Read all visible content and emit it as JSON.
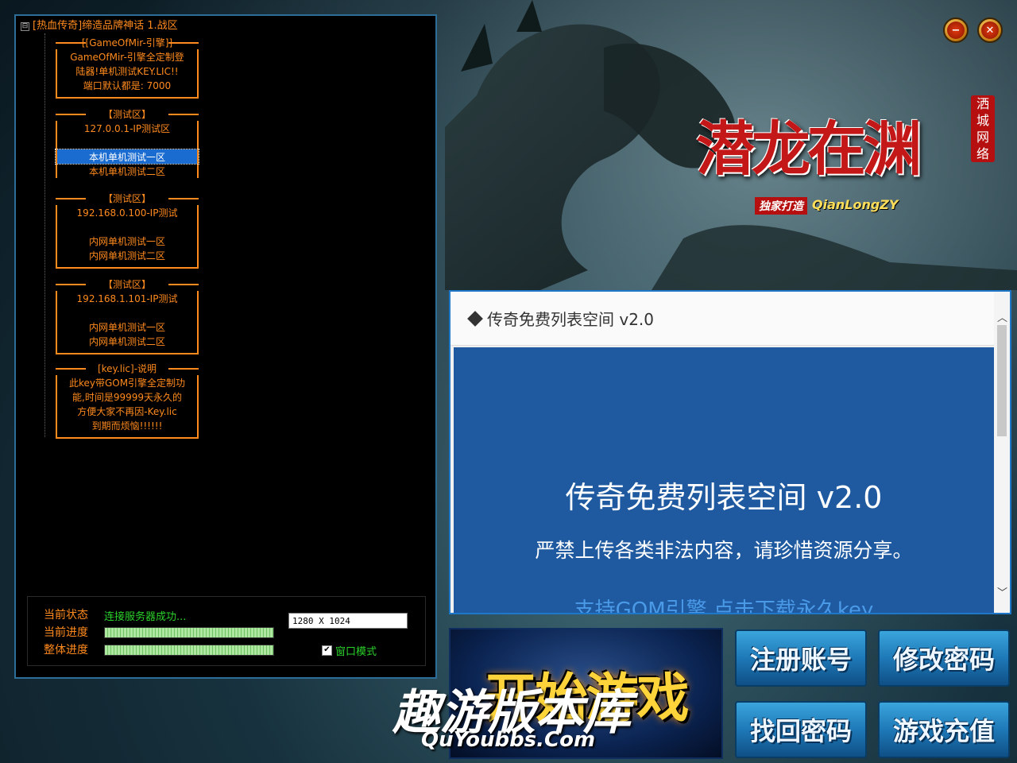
{
  "server_tree": {
    "root_label": "[热血传奇]缔造品牌神话 1.战区",
    "expander": "⊟",
    "groups": [
      {
        "top": "[[GameOfMir-引擎]]",
        "lines": [
          "GameOfMir-引擎全定制登",
          "陆器!单机测试KEY.LIC!!",
          "端口默认都是: 7000"
        ]
      },
      {
        "top": "【测试区】",
        "lines": [
          "127.0.0.1-IP测试区"
        ],
        "items": [
          "本机单机测试一区",
          "本机单机测试二区"
        ]
      },
      {
        "top": "【测试区】",
        "lines": [
          "192.168.0.100-IP测试"
        ],
        "items": [
          "内网单机测试一区",
          "内网单机测试二区"
        ]
      },
      {
        "top": "【测试区】",
        "lines": [
          "192.168.1.101-IP测试"
        ],
        "items": [
          "内网单机测试一区",
          "内网单机测试二区"
        ]
      },
      {
        "top": "[key.lic]-说明",
        "lines": [
          "此key带GOM引擎全定制功",
          "能,时间是99999天永久的",
          "方便大家不再因-Key.lic",
          "到期而烦恼!!!!!!"
        ]
      }
    ],
    "selected": "本机单机测试一区"
  },
  "status": {
    "state_label": "当前状态",
    "state_value": "连接服务器成功...",
    "progress_label": "当前进度",
    "overall_label": "整体进度",
    "current_progress": 1.0,
    "overall_progress": 1.0,
    "resolution": "1280 X 1024",
    "window_mode_label": "窗口模式",
    "window_mode_checked": true
  },
  "window_controls": {
    "minimize_icon": "minimize-icon",
    "close_icon": "close-icon",
    "min_glyph": "−",
    "close_glyph": "✕"
  },
  "logo": {
    "title": "潜龙在渊",
    "seal": "洒城网络",
    "tagline": "独家打造",
    "brand": "QianLongZY"
  },
  "browser": {
    "header": "传奇免费列表空间 v2.0",
    "heading": "传奇免费列表空间 v2.0",
    "notice": "严禁上传各类非法内容，请珍惜资源分享。",
    "link": "支持GOM引擎,点击下载永久key",
    "scroll_up": "︿",
    "scroll_down": "﹀"
  },
  "buttons": {
    "start": "开始游戏",
    "register": "注册账号",
    "change_password": "修改密码",
    "recover_password": "找回密码",
    "recharge": "游戏充值"
  },
  "watermark": {
    "cn": "趣游版本库",
    "en": "QuYoubbs.Com"
  },
  "colors": {
    "accent_orange": "#ff8a1e",
    "status_green": "#2bd12b",
    "panel_blue": "#1f5aa0",
    "button_blue": "#1e79b7",
    "start_gold": "#ffd43b"
  }
}
